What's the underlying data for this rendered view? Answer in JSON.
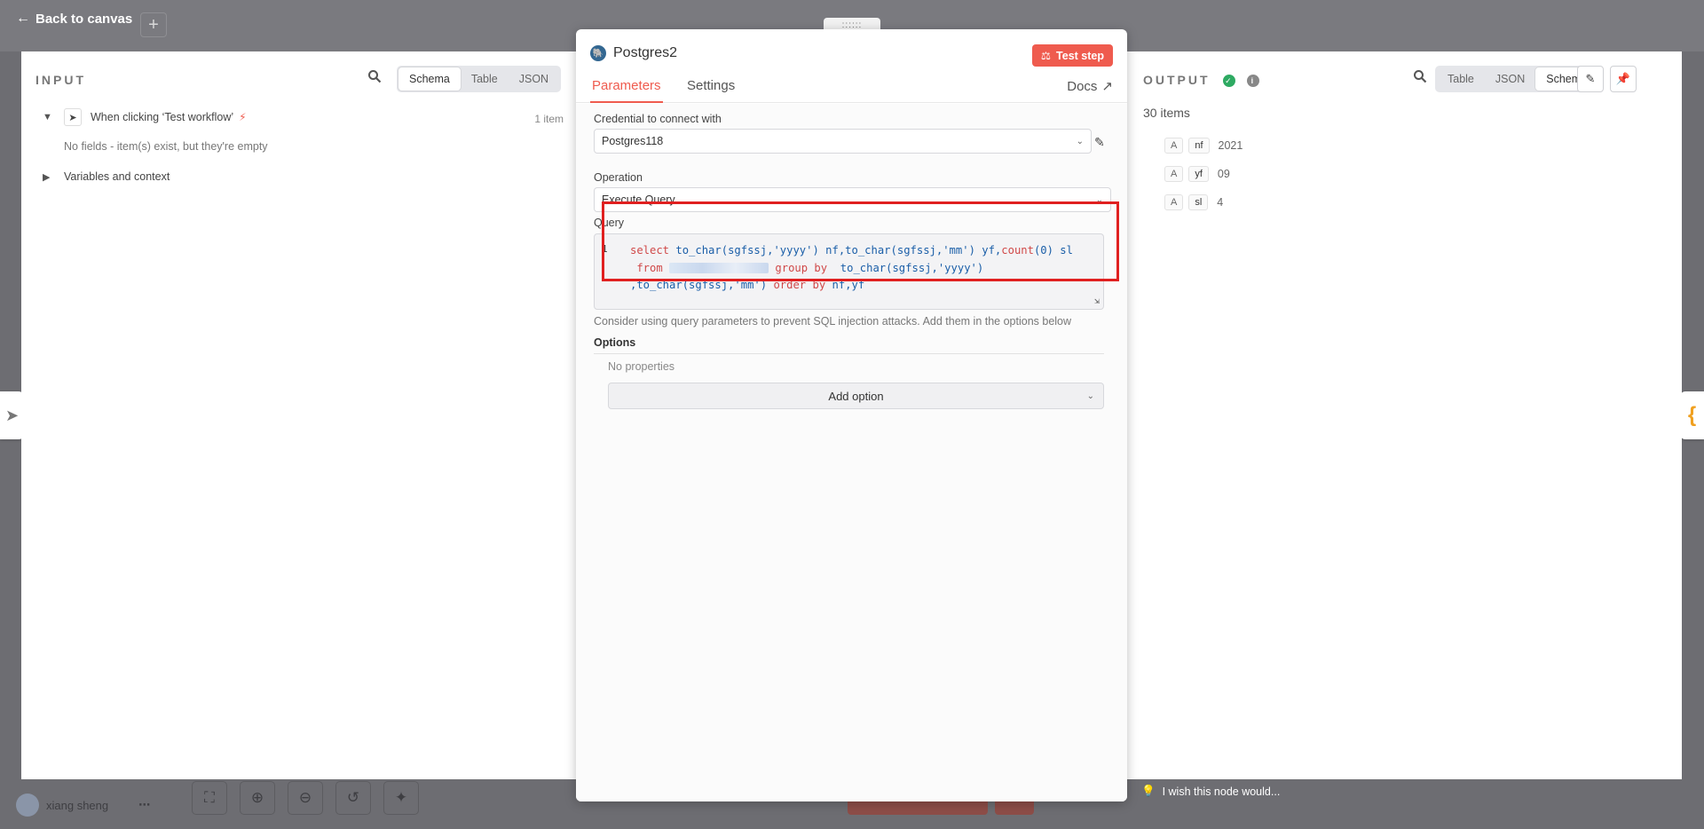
{
  "header": {
    "back_label": "Back to canvas",
    "plus": "+"
  },
  "input_panel": {
    "title": "INPUT",
    "view_tabs": [
      "Schema",
      "Table",
      "JSON"
    ],
    "active_tab": "Schema",
    "trigger_name": "When clicking ‘Test workflow’",
    "item_count": "1 item",
    "empty_note": "No fields - item(s) exist, but they're empty",
    "variables_label": "Variables and context"
  },
  "node": {
    "drag_handle": "::::::",
    "title": "Postgres2",
    "test_button": "Test step",
    "tabs": [
      "Parameters",
      "Settings"
    ],
    "docs_label": "Docs",
    "credential_label": "Credential to connect with",
    "credential_value": "Postgres118",
    "operation_label": "Operation",
    "operation_value": "Execute Query",
    "query_label": "Query",
    "line_number": "1",
    "query_hint": "Consider using query parameters to prevent SQL injection attacks. Add them in the options below",
    "options_label": "Options",
    "no_properties": "No properties",
    "add_option": "Add option"
  },
  "output_panel": {
    "title": "OUTPUT",
    "view_tabs": [
      "Table",
      "JSON",
      "Schema"
    ],
    "active_tab": "Schema",
    "item_count": "30 items",
    "fields": [
      {
        "type": "A",
        "key": "nf",
        "value": "2021"
      },
      {
        "type": "A",
        "key": "yf",
        "value": "09"
      },
      {
        "type": "A",
        "key": "sl",
        "value": "4"
      }
    ]
  },
  "footer": {
    "user_name": "xiang sheng",
    "wish_label": "I wish this node would..."
  },
  "colors": {
    "accent": "#ef5b4e",
    "success": "#2eaa62",
    "highlight_box": "#e02020"
  }
}
